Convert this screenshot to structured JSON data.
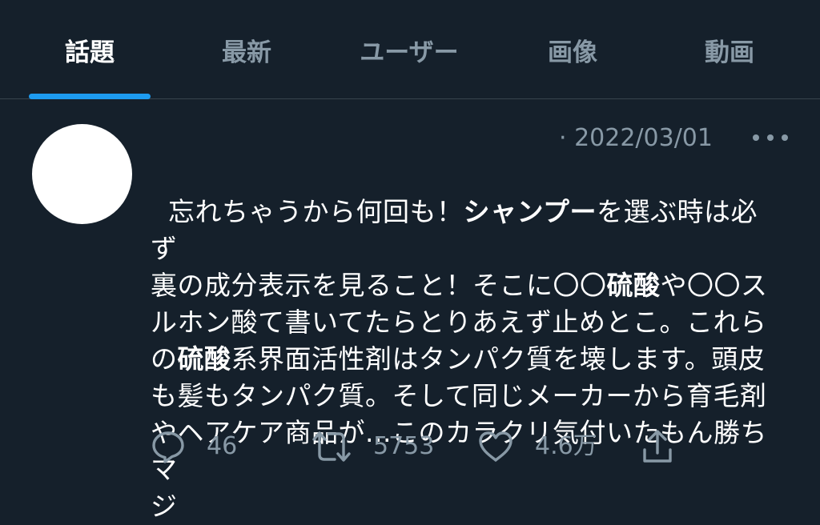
{
  "tabs": [
    {
      "label": "話題",
      "active": true
    },
    {
      "label": "最新",
      "active": false
    },
    {
      "label": "ユーザー",
      "active": false
    },
    {
      "label": "画像",
      "active": false
    },
    {
      "label": "動画",
      "active": false
    }
  ],
  "tweet": {
    "date": "· 2022/03/01",
    "text_segments": [
      {
        "text": "忘れちゃうから何回も！",
        "bold": false
      },
      {
        "text": "シャンプー",
        "bold": true
      },
      {
        "text": "を選ぶ時は必ず\n裏の成分表示を見ること！そこに〇〇",
        "bold": false
      },
      {
        "text": "硫酸",
        "bold": true
      },
      {
        "text": "や〇〇ス\nルホン酸て書いてたらとりあえず止めとこ。これら\nの",
        "bold": false
      },
      {
        "text": "硫酸",
        "bold": true
      },
      {
        "text": "系界面活性剤はタンパク質を壊します。頭皮\nも髪もタンパク質。そして同じメーカーから育毛剤\nやヘアケア商品が...このカラクリ気付いたもん勝ちマ\nジ",
        "bold": false
      }
    ],
    "replies": "46",
    "retweets": "5753",
    "likes": "4.6万"
  },
  "colors": {
    "background": "#15202b",
    "secondary_text": "#8899a6",
    "accent": "#1d9bf0",
    "divider": "#38444d"
  },
  "icons": [
    "reply-icon",
    "retweet-icon",
    "like-icon",
    "share-icon",
    "more-icon"
  ]
}
